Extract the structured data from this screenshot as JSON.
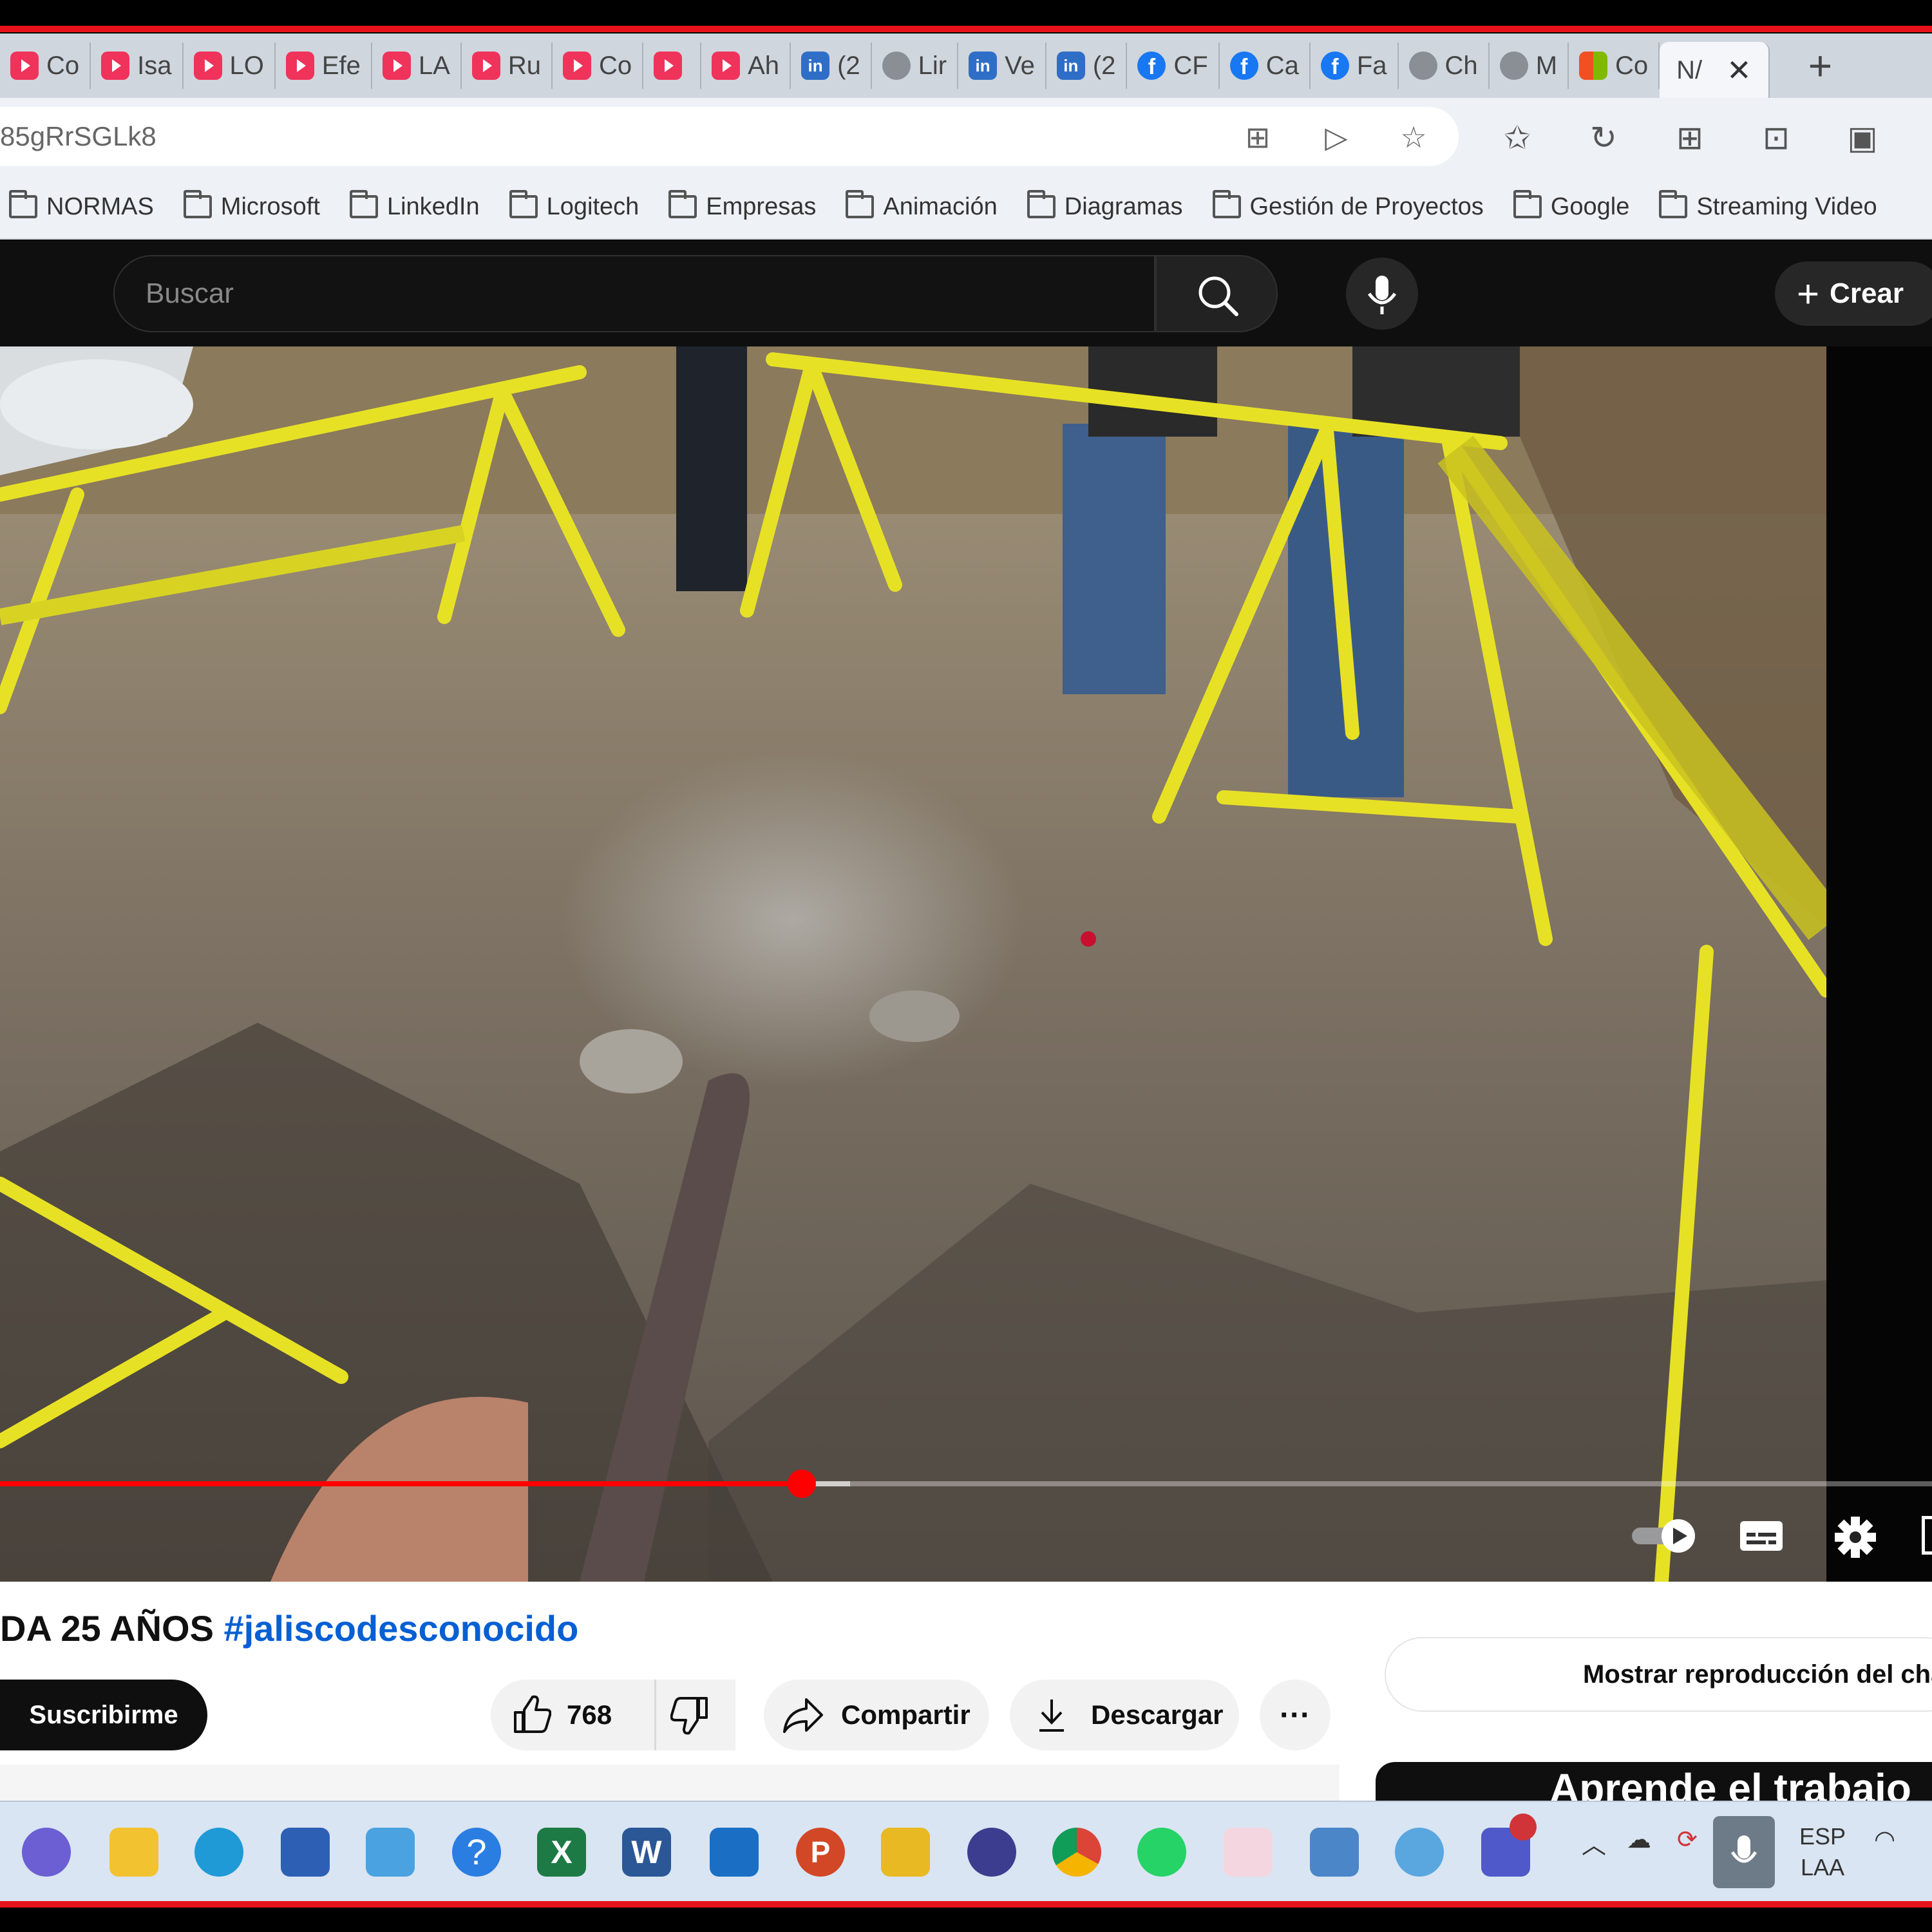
{
  "browser": {
    "tabs": [
      {
        "label": "Co",
        "icon": "youtube-icon"
      },
      {
        "label": "Isa",
        "icon": "youtube-icon"
      },
      {
        "label": "LO",
        "icon": "youtube-icon"
      },
      {
        "label": "Efe",
        "icon": "youtube-icon"
      },
      {
        "label": "LA",
        "icon": "youtube-icon"
      },
      {
        "label": "Ru",
        "icon": "youtube-icon"
      },
      {
        "label": "Co",
        "icon": "youtube-icon"
      },
      {
        "label": "",
        "icon": "youtube-icon"
      },
      {
        "label": "Ah",
        "icon": "youtube-icon"
      },
      {
        "label": "(2",
        "icon": "linkedin-icon"
      },
      {
        "label": "Lir",
        "icon": "web-icon"
      },
      {
        "label": "Ve",
        "icon": "linkedin-icon"
      },
      {
        "label": "(2",
        "icon": "linkedin-icon"
      },
      {
        "label": "CF",
        "icon": "facebook-icon"
      },
      {
        "label": "Ca",
        "icon": "facebook-icon"
      },
      {
        "label": "Fa",
        "icon": "facebook-icon"
      },
      {
        "label": "Ch",
        "icon": "globe-icon"
      },
      {
        "label": "M",
        "icon": "search-icon"
      },
      {
        "label": "Co",
        "icon": "microsoft-icon"
      }
    ],
    "active_tab": {
      "label": "N/"
    },
    "close_glyph": "✕",
    "new_tab_glyph": "+",
    "url": "85gRrSGLk8",
    "bookmarks": [
      "NORMAS",
      "Microsoft",
      "LinkedIn",
      "Logitech",
      "Empresas",
      "Animación",
      "Diagramas",
      "Gestión de Proyectos",
      "Google",
      "Streaming Video"
    ]
  },
  "youtube": {
    "search_placeholder": "Buscar",
    "create_label": "Crear",
    "video": {
      "progress_fraction": 0.415,
      "buffer_fraction": 0.44,
      "title_text": "DA 25 AÑOS ",
      "title_hashtag": "#jaliscodesconocido"
    },
    "subscribe_label": "Suscribirme",
    "like_count": "768",
    "share_label": "Compartir",
    "download_label": "Descargar",
    "more_glyph": "···",
    "chat_replay_label": "Mostrar reproducción del chat",
    "ad_text": "Aprende el trabajo"
  },
  "taskbar": {
    "lang_line1": "ESP",
    "lang_line2": "LAA"
  },
  "colors": {
    "accent_red": "#ff0000",
    "border_red": "#e8121b",
    "hashtag_blue": "#065fd4",
    "tape_yellow": "#e7e125"
  }
}
